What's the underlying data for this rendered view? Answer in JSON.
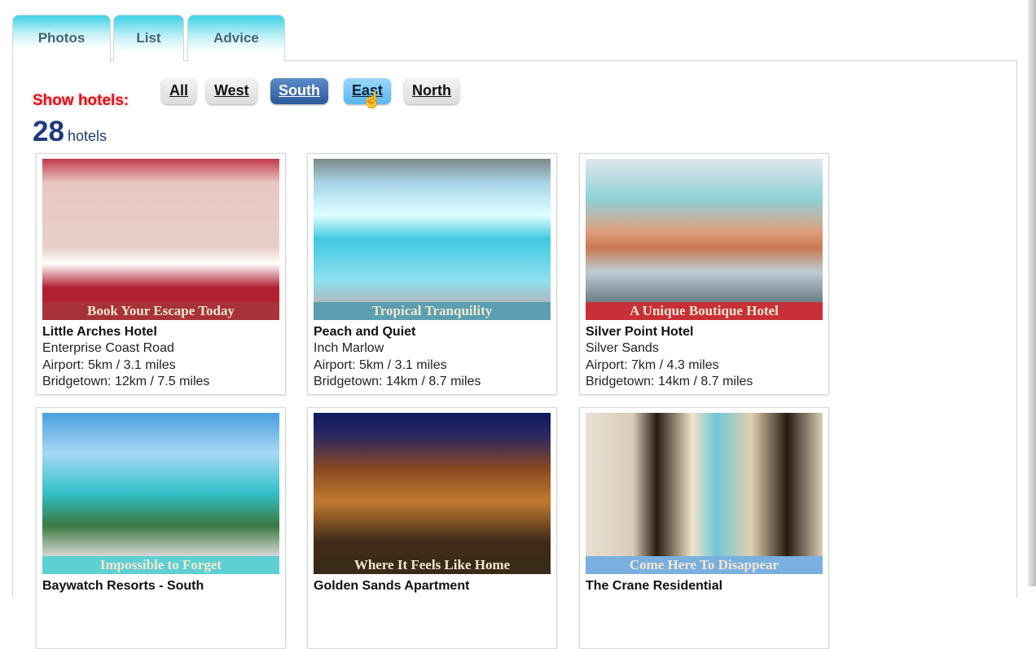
{
  "tabs": [
    {
      "label": "Photos"
    },
    {
      "label": "List"
    },
    {
      "label": "Advice"
    }
  ],
  "filter": {
    "label": "Show hotels:",
    "buttons": [
      "All",
      "West",
      "South",
      "East",
      "North"
    ],
    "selected": "South"
  },
  "count": {
    "number": "28",
    "unit": "hotels"
  },
  "hotels": [
    {
      "caption": "Book Your Escape Today",
      "name": "Little Arches Hotel",
      "area": "Enterprise Coast Road",
      "airport": "Airport: 5km / 3.1 miles",
      "town": "Bridgetown: 12km / 7.5 miles"
    },
    {
      "caption": "Tropical Tranquility",
      "name": "Peach and Quiet",
      "area": "Inch Marlow",
      "airport": "Airport: 5km / 3.1 miles",
      "town": "Bridgetown: 14km / 8.7 miles"
    },
    {
      "caption": "A Unique Boutique Hotel",
      "name": "Silver Point Hotel",
      "area": "Silver Sands",
      "airport": "Airport: 7km / 4.3 miles",
      "town": "Bridgetown: 14km / 8.7 miles"
    },
    {
      "caption": "Impossible to Forget",
      "name": "Baywatch Resorts - South"
    },
    {
      "caption": "Where It Feels Like Home",
      "name": "Golden Sands Apartment"
    },
    {
      "caption": "Come Here To Disappear",
      "name": "The Crane Residential"
    }
  ]
}
